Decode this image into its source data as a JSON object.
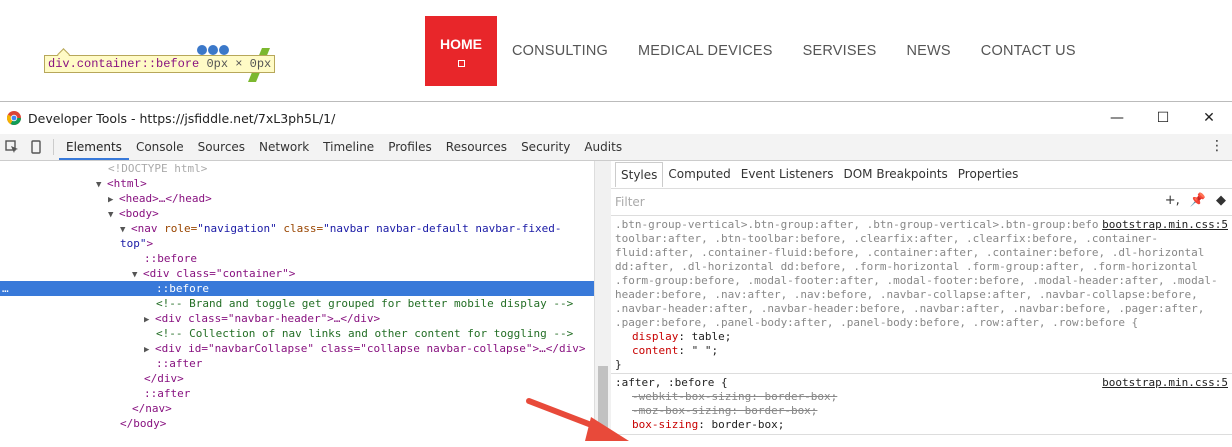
{
  "site": {
    "nav": [
      "CONSULTING",
      "MEDICAL DEVICES",
      "SERVISES",
      "NEWS",
      "CONTACT US"
    ],
    "home_label": "HOME",
    "tooltip": {
      "tag": "div.container::before",
      "size": "0px × 0px"
    },
    "accent": "#e8262a"
  },
  "devtools": {
    "title": "Developer Tools - https://jsfiddle.net/7xL3ph5L/1/",
    "tabs": [
      "Elements",
      "Console",
      "Sources",
      "Network",
      "Timeline",
      "Profiles",
      "Resources",
      "Security",
      "Audits"
    ],
    "active_tab": "Elements",
    "win_buttons": [
      "—",
      "☐",
      "✕"
    ]
  },
  "dom": {
    "doctype": "<!DOCTYPE html>",
    "html": "<html>",
    "head": "<head>…</head>",
    "body": "<body>",
    "nav_open_1": "<nav",
    "nav_attr1": " role=",
    "nav_val1": "\"navigation\"",
    "nav_attr2": " class=",
    "nav_val2": "\"navbar navbar-default navbar-fixed-",
    "nav_val2b": "top\"",
    "nav_close": ">",
    "before1": "::before",
    "container": "<div class=\"container\">",
    "before_sel": "::before",
    "comment1": "<!-- Brand and toggle get grouped for better mobile display -->",
    "navbar_header": "<div class=\"navbar-header\">…</div>",
    "comment2": "<!-- Collection of nav links and other content for toggling -->",
    "collapse": "<div id=\"navbarCollapse\" class=\"collapse navbar-collapse\">…</div>",
    "after1": "::after",
    "div_close": "</div>",
    "after2": "::after",
    "nav_end": "</nav>",
    "body_end": "</body>",
    "ellipsis": "…"
  },
  "styles": {
    "subtabs": [
      "Styles",
      "Computed",
      "Event Listeners",
      "DOM Breakpoints",
      "Properties"
    ],
    "filter_placeholder": "Filter",
    "rule1_src": "bootstrap.min.css:5",
    "rule1_selector": ".btn-group-vertical>.btn-group:after, .btn-group-vertical>.btn-group:before, .btn-toolbar:after, .btn-toolbar:before, .clearfix:after, .clearfix:before, .container-fluid:after, .container-fluid:before, .container:after, .container:before, .dl-horizontal dd:after, .dl-horizontal dd:before, .form-horizontal .form-group:after, .form-horizontal .form-group:before, .modal-footer:after, .modal-footer:before, .modal-header:after, .modal-header:before, .nav:after, .nav:before, .navbar-collapse:after, .navbar-collapse:before, .navbar-header:after, .navbar-header:before, .navbar:after, .navbar:before, .pager:after, .pager:before, .panel-body:after, .panel-body:before, .row:after, .row:before {",
    "decl1_prop": "display",
    "decl1_val": " table;",
    "decl2_prop": "content",
    "decl2_val": " \" \";",
    "rule1_close": "}",
    "rule2_src": "bootstrap.min.css:5",
    "rule2_selector": ":after, :before {",
    "decl3": "-webkit-box-sizing: border-box;",
    "decl4": "-moz-box-sizing: border-box;",
    "decl5_prop": "box-sizing",
    "decl5_val": " border-box;"
  }
}
